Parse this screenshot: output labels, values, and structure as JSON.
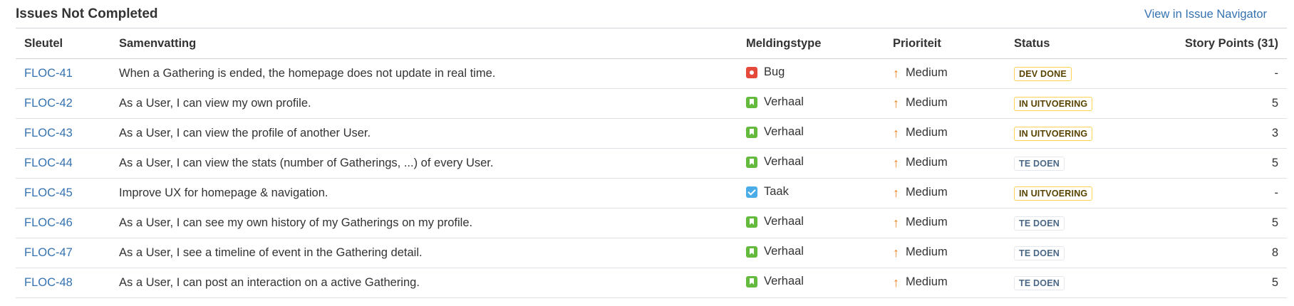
{
  "header": {
    "title": "Issues Not Completed",
    "nav_link": "View in Issue Navigator"
  },
  "columns": {
    "key": "Sleutel",
    "summary": "Samenvatting",
    "type": "Meldingstype",
    "priority": "Prioriteit",
    "status": "Status",
    "points": "Story Points (31)"
  },
  "status_colors": {
    "yellow": "#ffd351",
    "blue": "#e4e8ed",
    "link": "#3572b0",
    "priority_medium": "#f0801c"
  },
  "rows": [
    {
      "key": "FLOC-41",
      "summary": "When a Gathering is ended, the homepage does not update in real time.",
      "type": "Bug",
      "type_icon": "bug-icon",
      "priority": "Medium",
      "status": "DEV DONE",
      "status_color": "yellow",
      "points": "-"
    },
    {
      "key": "FLOC-42",
      "summary": "As a User, I can view my own profile.",
      "type": "Verhaal",
      "type_icon": "story-icon",
      "priority": "Medium",
      "status": "IN UITVOERING",
      "status_color": "yellow",
      "points": "5"
    },
    {
      "key": "FLOC-43",
      "summary": "As a User, I can view the profile of another User.",
      "type": "Verhaal",
      "type_icon": "story-icon",
      "priority": "Medium",
      "status": "IN UITVOERING",
      "status_color": "yellow",
      "points": "3"
    },
    {
      "key": "FLOC-44",
      "summary": "As a User, I can view the stats (number of Gatherings, ...) of every User.",
      "type": "Verhaal",
      "type_icon": "story-icon",
      "priority": "Medium",
      "status": "TE DOEN",
      "status_color": "blue",
      "points": "5"
    },
    {
      "key": "FLOC-45",
      "summary": "Improve UX for homepage & navigation.",
      "type": "Taak",
      "type_icon": "task-icon",
      "priority": "Medium",
      "status": "IN UITVOERING",
      "status_color": "yellow",
      "points": "-"
    },
    {
      "key": "FLOC-46",
      "summary": "As a User, I can see my own history of my Gatherings on my profile.",
      "type": "Verhaal",
      "type_icon": "story-icon",
      "priority": "Medium",
      "status": "TE DOEN",
      "status_color": "blue",
      "points": "5"
    },
    {
      "key": "FLOC-47",
      "summary": "As a User, I see a timeline of event in the Gathering detail.",
      "type": "Verhaal",
      "type_icon": "story-icon",
      "priority": "Medium",
      "status": "TE DOEN",
      "status_color": "blue",
      "points": "8"
    },
    {
      "key": "FLOC-48",
      "summary": "As a User, I can post an interaction on a active Gathering.",
      "type": "Verhaal",
      "type_icon": "story-icon",
      "priority": "Medium",
      "status": "TE DOEN",
      "status_color": "blue",
      "points": "5"
    }
  ]
}
